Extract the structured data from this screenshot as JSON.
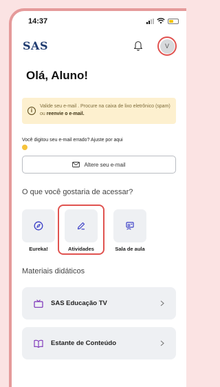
{
  "status_bar": {
    "time": "14:37"
  },
  "header": {
    "brand": "SAS",
    "avatar_initial": "V"
  },
  "greeting": "Olá, Aluno!",
  "warning": {
    "text_plain": "Valide seu e-mail . Procure na caixa de lixo eletrônico (spam) ou ",
    "text_link": "reenvie o e-mail."
  },
  "hint": "Você digitou seu e-mail errado? Ajuste por aqui",
  "alter_email_label": "Altere seu e-mail",
  "access_title": "O que você gostaria de acessar?",
  "shortcuts": [
    {
      "label": "Eureka!",
      "icon": "compass-icon"
    },
    {
      "label": "Atividades",
      "icon": "pencil-icon"
    },
    {
      "label": "Sala de aula",
      "icon": "classroom-icon"
    }
  ],
  "materials_title": "Materiais didáticos",
  "materials": [
    {
      "label": "SAS Educação TV",
      "icon": "tv-icon"
    },
    {
      "label": "Estante de Conteúdo",
      "icon": "book-icon"
    }
  ],
  "colors": {
    "accent": "#3b3fc7",
    "highlight": "#e0524f",
    "warning_bg": "#fdf0cf",
    "brand": "#1f3b70"
  }
}
